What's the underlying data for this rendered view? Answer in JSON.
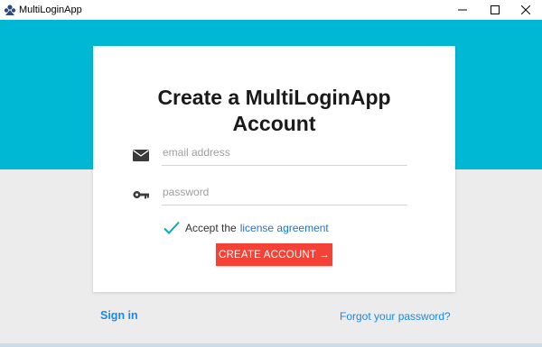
{
  "window": {
    "title": "MultiLoginApp",
    "icon": "multiloginapp-logo-icon",
    "controls": [
      "minimize-icon",
      "maximize-icon",
      "close-icon"
    ]
  },
  "card": {
    "title_line1": "Create a MultiLoginApp",
    "title_line2": "Account",
    "email_placeholder": "email address",
    "email_value": "",
    "password_placeholder": "password",
    "password_value": "",
    "accept_text": "Accept the",
    "license_link": "license agreement",
    "accept_checked": true,
    "create_button": "CREATE ACCOUNT →"
  },
  "footer": {
    "signin": "Sign in",
    "forgot": "Forgot your password?"
  },
  "colors": {
    "header_band": "#00b8d4",
    "button": "#f44336",
    "link": "#1e88e5",
    "check": "#00acc1"
  }
}
